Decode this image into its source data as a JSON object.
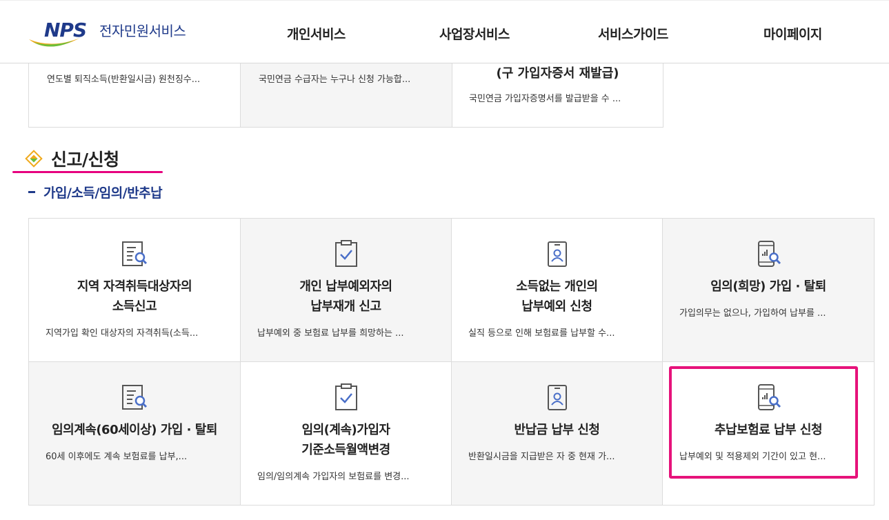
{
  "header": {
    "logo_mark": "NPS",
    "logo_text": "전자민원서비스",
    "nav": [
      "개인서비스",
      "사업장서비스",
      "서비스가이드",
      "마이페이지"
    ]
  },
  "top_row": [
    {
      "desc": "연도별 퇴직소득(반환일시금) 원천징수..."
    },
    {
      "desc": "국민연금 수급자는 누구나 신청 가능합..."
    },
    {
      "title": "(구 가입자증서 재발급)",
      "desc": "국민연금 가입자증명서를 발급받을 수 ..."
    }
  ],
  "section": {
    "title": "신고/신청",
    "subtitle": "가입/소득/임의/반추납"
  },
  "cards": [
    {
      "title1": "지역 자격취득대상자의",
      "title2": "소득신고",
      "desc": "지역가입 확인 대상자의 자격취득(소득...",
      "icon": "document-search-icon"
    },
    {
      "title1": "개인 납부예외자의",
      "title2": "납부재개 신고",
      "desc": "납부예외 중 보험료 납부를 희망하는 ...",
      "icon": "clipboard-check-icon"
    },
    {
      "title1": "소득없는 개인의",
      "title2": "납부예외 신청",
      "desc": "실직 등으로 인해 보험료를 납부할 수...",
      "icon": "id-badge-icon"
    },
    {
      "title1": "임의(희망) 가입 · 탈퇴",
      "title2": "",
      "desc": "가입의무는 없으나, 가입하여 납부를 ...",
      "icon": "mobile-chart-search-icon"
    },
    {
      "title1": "임의계속(60세이상) 가입 · 탈퇴",
      "title2": "",
      "desc": "60세 이후에도 계속 보험료를 납부,...",
      "icon": "document-search-icon"
    },
    {
      "title1": "임의(계속)가입자",
      "title2": "기준소득월액변경",
      "desc": "임의/임의계속 가입자의 보험료를 변경...",
      "icon": "clipboard-check-icon"
    },
    {
      "title1": "반납금 납부 신청",
      "title2": "",
      "desc": "반환일시금을 지급받은 자 중 현재 가...",
      "icon": "id-badge-icon"
    },
    {
      "title1": "추납보험료 납부 신청",
      "title2": "",
      "desc": "납부예외 및 적용제외 기간이 있고 현...",
      "icon": "mobile-chart-search-icon"
    }
  ],
  "colors": {
    "brand_blue": "#1f3a8a",
    "highlight_pink": "#e6127a",
    "icon_blue": "#4a6fc8",
    "icon_gray": "#555555"
  }
}
